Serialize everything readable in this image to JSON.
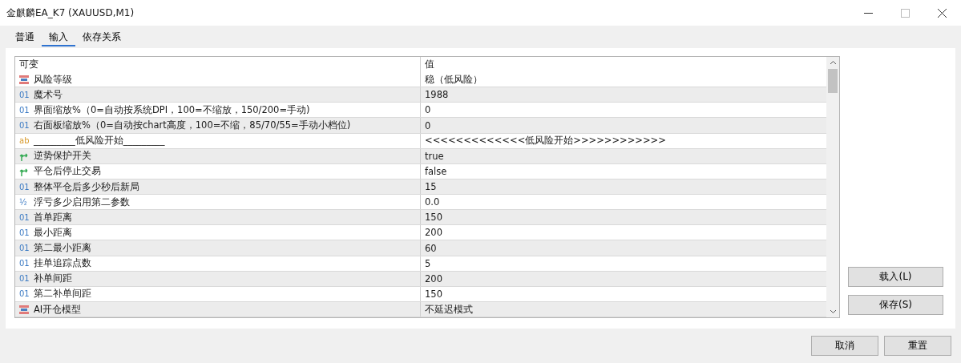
{
  "window": {
    "title": "金麒麟EA_K7 (XAUUSD,M1)"
  },
  "tabs": [
    {
      "label": "普通",
      "selected": false
    },
    {
      "label": "输入",
      "selected": true
    },
    {
      "label": "依存关系",
      "selected": false
    }
  ],
  "table": {
    "columns": [
      "可变",
      "值"
    ],
    "rows": [
      {
        "kind": "enum",
        "name": "风险等级",
        "value": "稳（低风险）"
      },
      {
        "kind": "int",
        "type_text": "01",
        "name": "魔术号",
        "value": "1988"
      },
      {
        "kind": "int",
        "type_text": "01",
        "name": "界面缩放%（0=自动按系统DPI，100=不缩放，150/200=手动)",
        "value": "0"
      },
      {
        "kind": "int",
        "type_text": "01",
        "name": "右面板缩放%（0=自动按chart高度，100=不缩，85/70/55=手动小档位)",
        "value": "0"
      },
      {
        "kind": "string",
        "type_text": "ab",
        "name": "_________低风险开始_________",
        "value": "<<<<<<<<<<<<<低风险开始>>>>>>>>>>>>"
      },
      {
        "kind": "bool",
        "name": "逆势保护开关",
        "value": "true"
      },
      {
        "kind": "bool",
        "name": "平仓后停止交易",
        "value": "false"
      },
      {
        "kind": "int",
        "type_text": "01",
        "name": "整体平仓后多少秒后新局",
        "value": "15"
      },
      {
        "kind": "double",
        "type_text": "½",
        "name": "浮亏多少启用第二参数",
        "value": "0.0"
      },
      {
        "kind": "int",
        "type_text": "01",
        "name": "首单距离",
        "value": "150"
      },
      {
        "kind": "int",
        "type_text": "01",
        "name": "最小距离",
        "value": "200"
      },
      {
        "kind": "int",
        "type_text": "01",
        "name": "第二最小距离",
        "value": "60"
      },
      {
        "kind": "int",
        "type_text": "01",
        "name": "挂单追踪点数",
        "value": "5"
      },
      {
        "kind": "int",
        "type_text": "01",
        "name": "补单间距",
        "value": "200"
      },
      {
        "kind": "int",
        "type_text": "01",
        "name": "第二补单间距",
        "value": "150"
      },
      {
        "kind": "enum",
        "name": "AI开仓模型",
        "value": "不延迟模式"
      }
    ]
  },
  "side_buttons": [
    "载入(L)",
    "保存(S)"
  ],
  "footer_buttons": [
    "取消",
    "重置"
  ]
}
